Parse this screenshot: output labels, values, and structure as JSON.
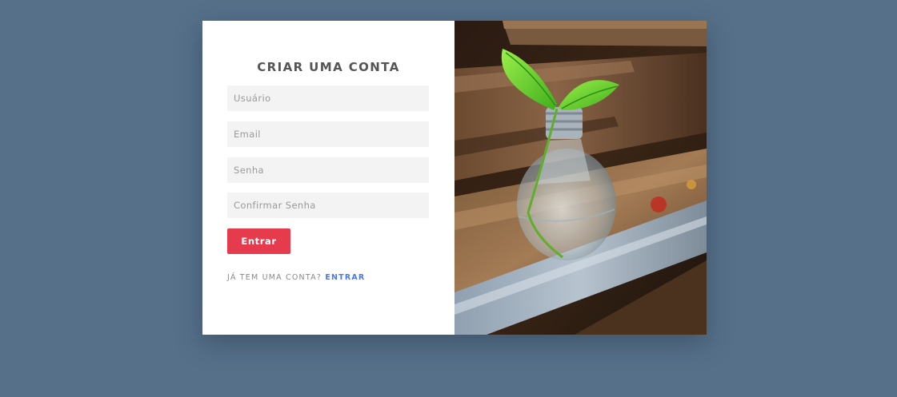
{
  "form": {
    "title": "CRIAR UMA CONTA",
    "username_placeholder": "Usuário",
    "email_placeholder": "Email",
    "password_placeholder": "Senha",
    "confirm_password_placeholder": "Confirmar Senha",
    "submit_label": "Entrar",
    "footer_text": "JÁ TEM UMA CONTA?",
    "footer_link": "ENTRAR"
  },
  "colors": {
    "background": "#56708a",
    "card": "#ffffff",
    "button": "#e63b4d",
    "link": "#4a78e8",
    "field": "#f3f3f3"
  },
  "image": {
    "icon": "lightbulb-plant-photo"
  }
}
